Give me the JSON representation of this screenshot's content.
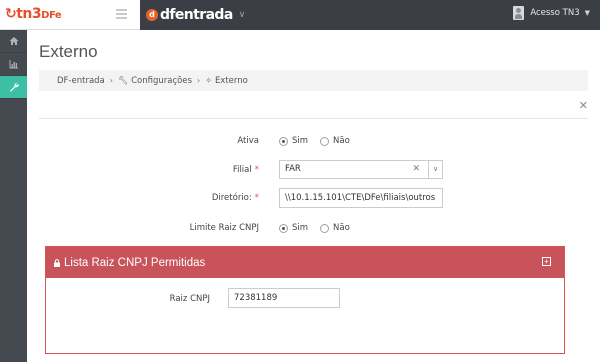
{
  "brand": {
    "logo_main": "tn3",
    "logo_sub": "DFe"
  },
  "app": {
    "logo_text": "dfentrada"
  },
  "user": {
    "name": "Acesso TN3"
  },
  "sidebar": {
    "items": [
      {
        "icon": "home-icon"
      },
      {
        "icon": "bar-chart-icon"
      },
      {
        "icon": "wrench-icon"
      }
    ]
  },
  "page": {
    "title": "Externo"
  },
  "breadcrumb": {
    "items": [
      "DF-entrada",
      "Configurações",
      "Externo"
    ]
  },
  "form": {
    "ativa": {
      "label": "Ativa",
      "options": [
        "Sim",
        "Não"
      ],
      "selected": "Sim"
    },
    "filial": {
      "label": "Filial",
      "value": "FAR"
    },
    "diretorio": {
      "label": "Diretório:",
      "value": "\\\\10.1.15.101\\CTE\\DFe\\filiais\\outros"
    },
    "limite": {
      "label": "Limite Raiz CNPJ",
      "options": [
        "Sim",
        "Não"
      ],
      "selected": "Sim"
    }
  },
  "panel": {
    "title": "Lista Raiz CNPJ Permitidas",
    "field_label": "Raiz CNPJ",
    "field_value": "72381189"
  },
  "colors": {
    "accent": "#3dbfa5",
    "panel_header": "#c9535a",
    "topbar": "#3b3f45",
    "brand": "#e2522a"
  }
}
